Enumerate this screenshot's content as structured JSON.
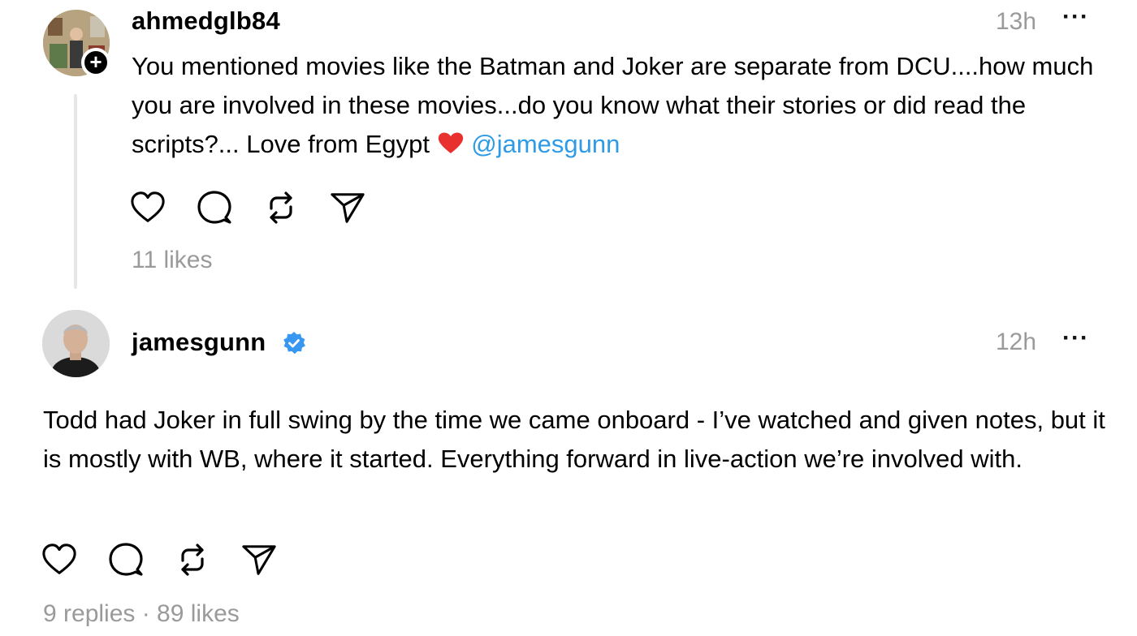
{
  "posts": [
    {
      "username": "ahmedglb84",
      "time": "13h",
      "more": "···",
      "text": "You mentioned movies like the Batman and Joker are separate from DCU....how much you are involved in these movies...do you know what their stories or did read the scripts?... Love from Egypt ",
      "emoji": "red-heart",
      "mention": "@jamesgunn",
      "stats": "11 likes"
    },
    {
      "username": "jamesgunn",
      "verified": true,
      "time": "12h",
      "more": "···",
      "text": "Todd had Joker in full swing by the time we came onboard - I’ve watched and given notes, but it is mostly with WB, where it started. Everything forward in live-action we’re involved with.",
      "stats": "9 replies · 89 likes"
    }
  ],
  "colors": {
    "mention": "#2e9be6",
    "muted": "#9a9a9a",
    "verified": "#3897f0",
    "thread_line": "#e6e6e6"
  },
  "icons": [
    "heart-icon",
    "comment-icon",
    "repost-icon",
    "share-icon"
  ]
}
